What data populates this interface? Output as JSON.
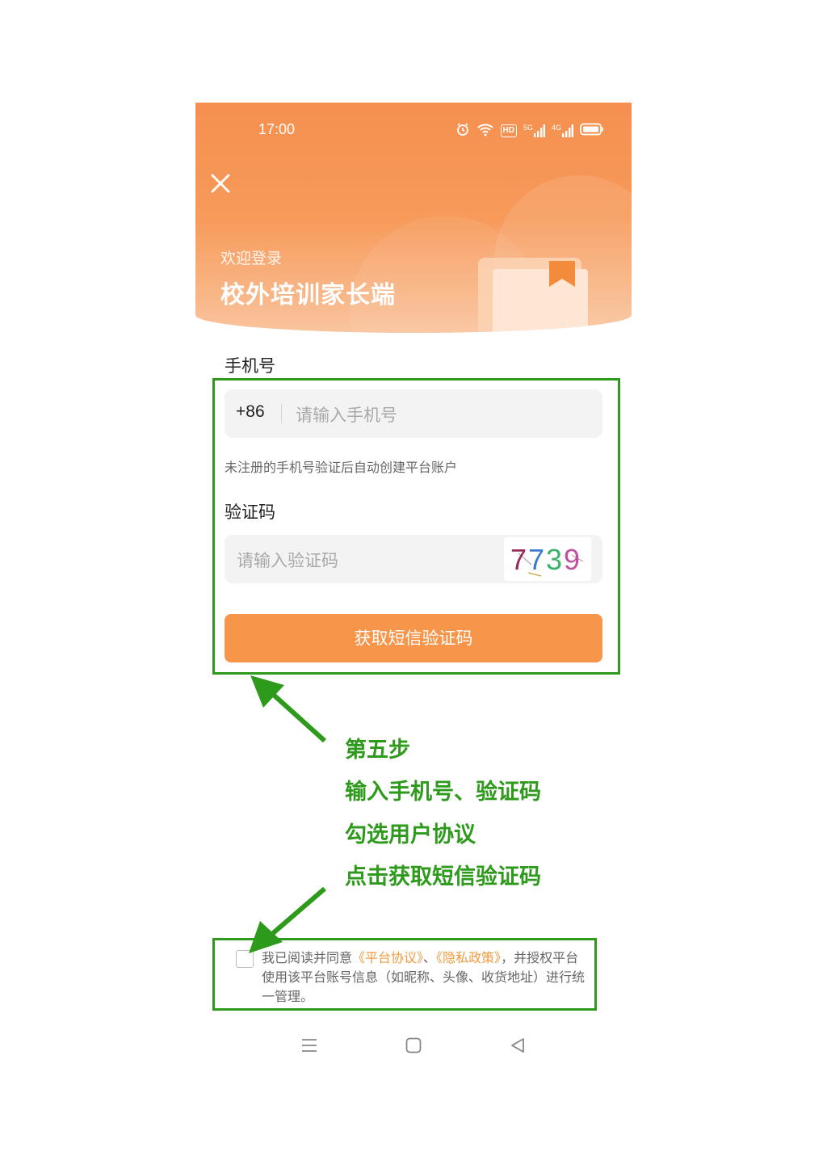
{
  "status_bar": {
    "time": "17:00",
    "icons": [
      "alarm-icon",
      "wifi-icon",
      "hd-icon",
      "signal-5g-icon",
      "signal-4g-icon",
      "battery-icon"
    ],
    "hd_label": "HD",
    "net1": "5G",
    "net2": "4G"
  },
  "header": {
    "welcome": "欢迎登录",
    "title": "校外培训家长端"
  },
  "form": {
    "phone_label": "手机号",
    "country_code": "+86",
    "phone_placeholder": "请输入手机号",
    "hint": "未注册的手机号验证后自动创建平台账户",
    "code_label": "验证码",
    "code_placeholder": "请输入验证码",
    "captcha_text": "7739",
    "sms_button": "获取短信验证码"
  },
  "agreement": {
    "checked": false,
    "prefix": "我已阅读并同意",
    "platform_link": "《平台协议》",
    "sep": "、",
    "privacy_link": "《隐私政策》",
    "suffix": "，并授权平台使用该平台账号信息（如昵称、头像、收货地址）进行统一管理。"
  },
  "navbar": {
    "icons": [
      "menu-icon",
      "home-icon",
      "back-icon"
    ]
  },
  "annotation": {
    "line1": "第五步",
    "line2": "输入手机号、验证码",
    "line3": "勾选用户协议",
    "line4": "点击获取短信验证码",
    "color": "#2e9a1c"
  },
  "colors": {
    "brand": "#f7954a",
    "link": "#f29a3f"
  }
}
